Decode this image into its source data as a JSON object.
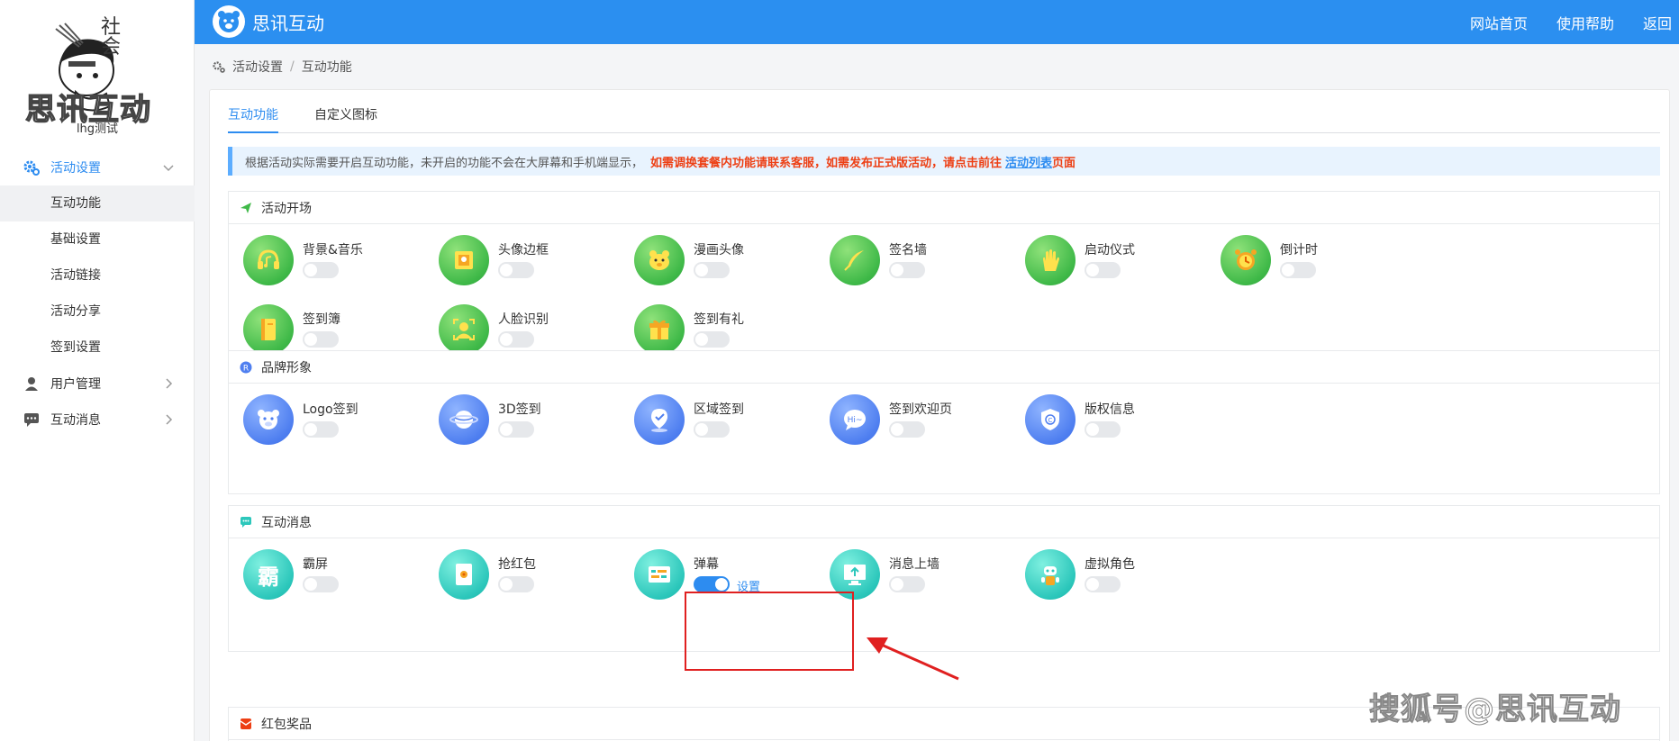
{
  "sidebar": {
    "logo_text": "思讯互动",
    "logo_stamp": "社会",
    "user_name": "lhg测试",
    "menu": [
      {
        "label": "活动设置",
        "icon": "gear-icon"
      },
      {
        "label": "用户管理",
        "icon": "user-icon"
      },
      {
        "label": "互动消息",
        "icon": "message-icon"
      }
    ],
    "sub_items": [
      "互动功能",
      "基础设置",
      "活动链接",
      "活动分享",
      "签到设置"
    ]
  },
  "header": {
    "brand": "思讯互动",
    "links": [
      "网站首页",
      "使用帮助",
      "返回"
    ]
  },
  "breadcrumb": [
    "活动设置",
    "互动功能"
  ],
  "tabs": [
    "互动功能",
    "自定义图标"
  ],
  "notice": {
    "text": "根据活动实际需要开启互动功能，未开启的功能不会在大屏幕和手机端显示，",
    "warning": "如需调换套餐内功能请联系客服，如需发布正式版活动，请点击前往",
    "link": "活动列表",
    "suffix": "页面"
  },
  "sections": {
    "opening": {
      "title": "活动开场",
      "items": [
        "背景&音乐",
        "头像边框",
        "漫画头像",
        "签名墙",
        "启动仪式",
        "倒计时",
        "签到簿",
        "人脸识别",
        "签到有礼"
      ]
    },
    "brand": {
      "title": "品牌形象",
      "items": [
        "Logo签到",
        "3D签到",
        "区域签到",
        "签到欢迎页",
        "版权信息"
      ]
    },
    "interact": {
      "title": "互动消息",
      "items": [
        "霸屏",
        "抢红包",
        "弹幕",
        "消息上墙",
        "虚拟角色"
      ],
      "icon_text_bully": "霸",
      "settings_label": "设置",
      "icon_text_hi": "Hi~"
    },
    "redpacket": {
      "title": "红包奖品"
    }
  },
  "watermark": "搜狐号@思讯互动",
  "colors": {
    "accent": "#2b8ff0",
    "warning": "#ed3f14",
    "highlight": "#e02020"
  }
}
